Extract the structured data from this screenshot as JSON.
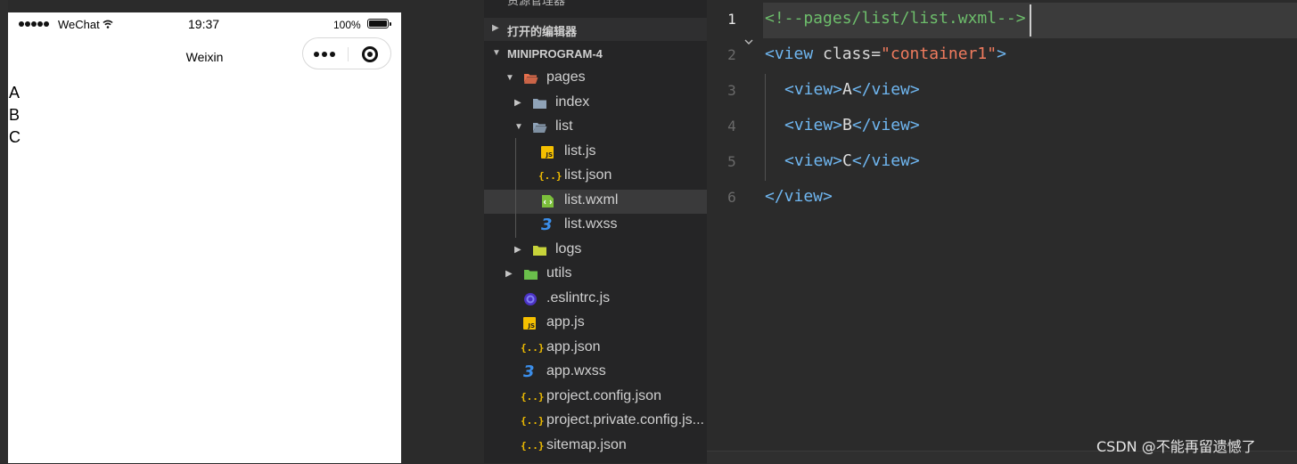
{
  "simulator": {
    "status_bar": {
      "carrier": "WeChat",
      "time": "19:37",
      "battery_percent": "100%",
      "signal_icon": "signal-dots-icon",
      "wifi_icon": "wifi-icon",
      "battery_icon": "battery-full-icon"
    },
    "nav_bar": {
      "title": "Weixin",
      "more_icon": "more-dots-icon",
      "close_icon": "record-close-icon"
    },
    "page_items": [
      "A",
      "B",
      "C"
    ]
  },
  "explorer": {
    "header_cut": "资源管理器",
    "open_editors": "打开的编辑器",
    "project": "MINIPROGRAM-4",
    "items": [
      {
        "name": "pages",
        "type": "folder-open",
        "color": "#e8704d"
      },
      {
        "name": "index",
        "type": "folder",
        "color": "#8fa3b8"
      },
      {
        "name": "list",
        "type": "folder-open",
        "color": "#8fa3b8"
      },
      {
        "name": "list.js",
        "type": "js"
      },
      {
        "name": "list.json",
        "type": "json"
      },
      {
        "name": "list.wxml",
        "type": "wxml",
        "selected": true
      },
      {
        "name": "list.wxss",
        "type": "css"
      },
      {
        "name": "logs",
        "type": "folder",
        "color": "#c7d33a"
      },
      {
        "name": "utils",
        "type": "folder",
        "color": "#6abf4b"
      },
      {
        "name": ".eslintrc.js",
        "type": "eslint"
      },
      {
        "name": "app.js",
        "type": "js"
      },
      {
        "name": "app.json",
        "type": "json"
      },
      {
        "name": "app.wxss",
        "type": "css"
      },
      {
        "name": "project.config.json",
        "type": "json"
      },
      {
        "name": "project.private.config.js...",
        "type": "json"
      },
      {
        "name": "sitemap.json",
        "type": "json"
      }
    ]
  },
  "editor": {
    "line_numbers": [
      "1",
      "2",
      "3",
      "4",
      "5",
      "6"
    ],
    "active_line": "1",
    "lines": {
      "l1_comment": "<!--pages/list/list.wxml-->",
      "l2_open": "<view",
      "l2_attr": " class=",
      "l2_value": "\"container1\"",
      "l2_close": ">",
      "l3_open": "<view>",
      "l3_text": "A",
      "l3_close": "</view>",
      "l4_open": "<view>",
      "l4_text": "B",
      "l4_close": "</view>",
      "l5_open": "<view>",
      "l5_text": "C",
      "l5_close": "</view>",
      "l6_close": "</view>"
    },
    "colors": {
      "comment": "#6dbd6b",
      "tag": "#6fb6f0",
      "string": "#f07b5e",
      "background": "#2b2b2b"
    }
  },
  "watermark": "CSDN @不能再留遗憾了"
}
